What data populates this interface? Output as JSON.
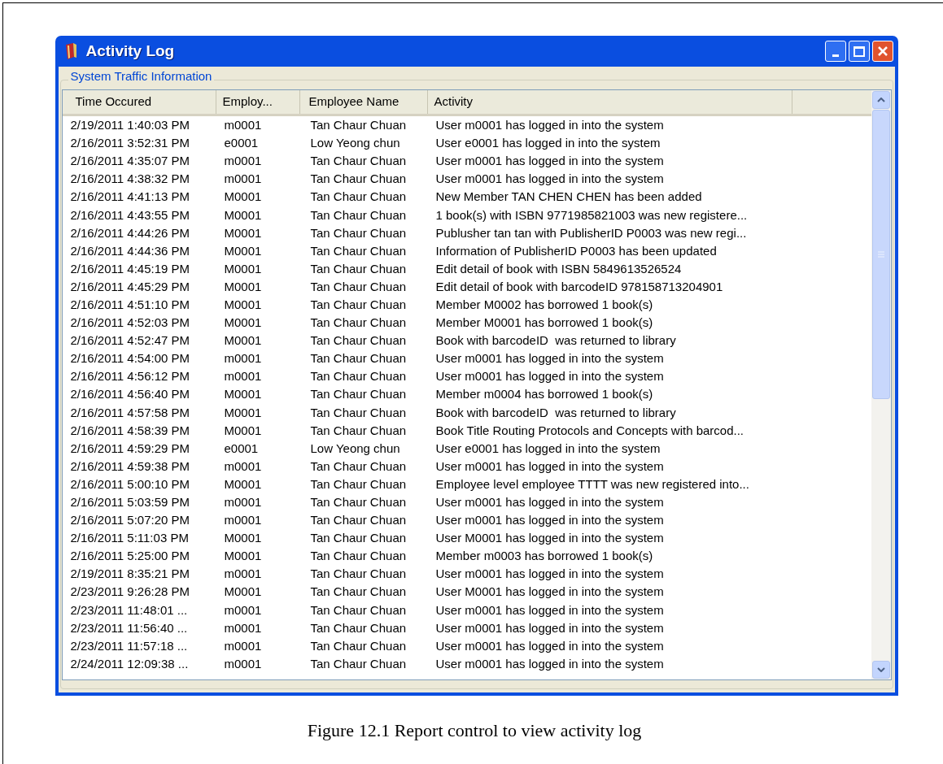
{
  "window": {
    "title": "Activity Log"
  },
  "group": {
    "label": "System Traffic Information"
  },
  "table": {
    "columns": [
      "Time Occured",
      "Employ...",
      "Employee Name",
      "Activity"
    ],
    "rows": [
      [
        "2/19/2011 1:40:03 PM",
        "m0001",
        "Tan Chaur Chuan",
        "User m0001 has logged in into the system"
      ],
      [
        "2/16/2011 3:52:31 PM",
        "e0001",
        "Low Yeong chun",
        "User e0001 has logged in into the system"
      ],
      [
        "2/16/2011 4:35:07 PM",
        "m0001",
        "Tan Chaur Chuan",
        "User m0001 has logged in into the system"
      ],
      [
        "2/16/2011 4:38:32 PM",
        "m0001",
        "Tan Chaur Chuan",
        "User m0001 has logged in into the system"
      ],
      [
        "2/16/2011 4:41:13 PM",
        "M0001",
        "Tan Chaur Chuan",
        "New Member TAN CHEN CHEN has been added"
      ],
      [
        "2/16/2011 4:43:55 PM",
        "M0001",
        "Tan Chaur Chuan",
        "1 book(s) with ISBN 9771985821003 was new registere..."
      ],
      [
        "2/16/2011 4:44:26 PM",
        "M0001",
        "Tan Chaur Chuan",
        "Publusher tan tan with PublisherID P0003 was new regi..."
      ],
      [
        "2/16/2011 4:44:36 PM",
        "M0001",
        "Tan Chaur Chuan",
        "Information of PublisherID P0003 has been updated"
      ],
      [
        "2/16/2011 4:45:19 PM",
        "M0001",
        "Tan Chaur Chuan",
        "Edit detail of book with ISBN 5849613526524"
      ],
      [
        "2/16/2011 4:45:29 PM",
        "M0001",
        "Tan Chaur Chuan",
        "Edit detail of book with barcodeID 978158713204901"
      ],
      [
        "2/16/2011 4:51:10 PM",
        "M0001",
        "Tan Chaur Chuan",
        "Member M0002 has borrowed 1 book(s)"
      ],
      [
        "2/16/2011 4:52:03 PM",
        "M0001",
        "Tan Chaur Chuan",
        "Member M0001 has borrowed 1 book(s)"
      ],
      [
        "2/16/2011 4:52:47 PM",
        "M0001",
        "Tan Chaur Chuan",
        "Book with barcodeID  was returned to library"
      ],
      [
        "2/16/2011 4:54:00 PM",
        "m0001",
        "Tan Chaur Chuan",
        "User m0001 has logged in into the system"
      ],
      [
        "2/16/2011 4:56:12 PM",
        "m0001",
        "Tan Chaur Chuan",
        "User m0001 has logged in into the system"
      ],
      [
        "2/16/2011 4:56:40 PM",
        "M0001",
        "Tan Chaur Chuan",
        "Member m0004 has borrowed 1 book(s)"
      ],
      [
        "2/16/2011 4:57:58 PM",
        "M0001",
        "Tan Chaur Chuan",
        "Book with barcodeID  was returned to library"
      ],
      [
        "2/16/2011 4:58:39 PM",
        "M0001",
        "Tan Chaur Chuan",
        "Book Title Routing Protocols and Concepts with barcod..."
      ],
      [
        "2/16/2011 4:59:29 PM",
        "e0001",
        "Low Yeong chun",
        "User e0001 has logged in into the system"
      ],
      [
        "2/16/2011 4:59:38 PM",
        "m0001",
        "Tan Chaur Chuan",
        "User m0001 has logged in into the system"
      ],
      [
        "2/16/2011 5:00:10 PM",
        "M0001",
        "Tan Chaur Chuan",
        "Employee level employee TTTT was new registered into..."
      ],
      [
        "2/16/2011 5:03:59 PM",
        "m0001",
        "Tan Chaur Chuan",
        "User m0001 has logged in into the system"
      ],
      [
        "2/16/2011 5:07:20 PM",
        "m0001",
        "Tan Chaur Chuan",
        "User m0001 has logged in into the system"
      ],
      [
        "2/16/2011 5:11:03 PM",
        "M0001",
        "Tan Chaur Chuan",
        "User M0001 has logged in into the system"
      ],
      [
        "2/16/2011 5:25:00 PM",
        "M0001",
        "Tan Chaur Chuan",
        "Member m0003 has borrowed 1 book(s)"
      ],
      [
        "2/19/2011 8:35:21 PM",
        "m0001",
        "Tan Chaur Chuan",
        "User m0001 has logged in into the system"
      ],
      [
        "2/23/2011 9:26:28 PM",
        "M0001",
        "Tan Chaur Chuan",
        "User M0001 has logged in into the system"
      ],
      [
        "2/23/2011 11:48:01 ...",
        "m0001",
        "Tan Chaur Chuan",
        "User m0001 has logged in into the system"
      ],
      [
        "2/23/2011 11:56:40 ...",
        "m0001",
        "Tan Chaur Chuan",
        "User m0001 has logged in into the system"
      ],
      [
        "2/23/2011 11:57:18 ...",
        "m0001",
        "Tan Chaur Chuan",
        "User m0001 has logged in into the system"
      ],
      [
        "2/24/2011 12:09:38 ...",
        "m0001",
        "Tan Chaur Chuan",
        "User m0001 has logged in into the system"
      ]
    ]
  },
  "caption": "Figure 12.1 Report control to view activity log"
}
